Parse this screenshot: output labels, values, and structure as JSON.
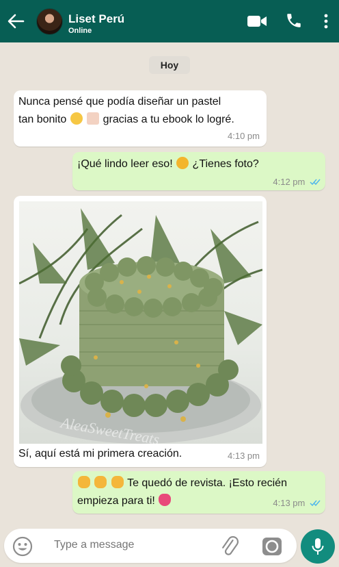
{
  "header": {
    "contact_name": "Liset Perú",
    "status": "Online",
    "background": "#075e54"
  },
  "chat": {
    "day_label": "Hoy",
    "messages": [
      {
        "direction": "incoming",
        "line1": "Nunca pensé que podía diseñar un pastel",
        "line2_a": "tan bonito",
        "line2_b": "gracias a tu ebook lo logré.",
        "emojis": [
          "face-holding-back-tears",
          "birthday-cake"
        ],
        "time": "4:10 pm"
      },
      {
        "direction": "outgoing",
        "text_a": "¡Qué lindo leer eso!",
        "text_b": "¿Tienes foto?",
        "emojis": [
          "heart-eyes"
        ],
        "time": "4:12 pm",
        "read": true
      },
      {
        "direction": "incoming",
        "image": "green-frosted-cake-photo",
        "watermark": "AleaSweetTreats",
        "caption": "Sí, aquí está mi primera creación.",
        "time": "4:13 pm"
      },
      {
        "direction": "outgoing",
        "line1": "Te quedó de revista. ¡Esto recién",
        "line2": "empieza para ti!",
        "emojis": [
          "clapping-hands",
          "clapping-hands",
          "clapping-hands",
          "growing-heart"
        ],
        "time": "4:13 pm",
        "read": true
      }
    ]
  },
  "composer": {
    "placeholder": "Type a message"
  },
  "colors": {
    "incoming_bubble": "#ffffff",
    "outgoing_bubble": "#dcf8c6",
    "read_ticks": "#4fb6ec",
    "mic_button": "#128c7e"
  }
}
